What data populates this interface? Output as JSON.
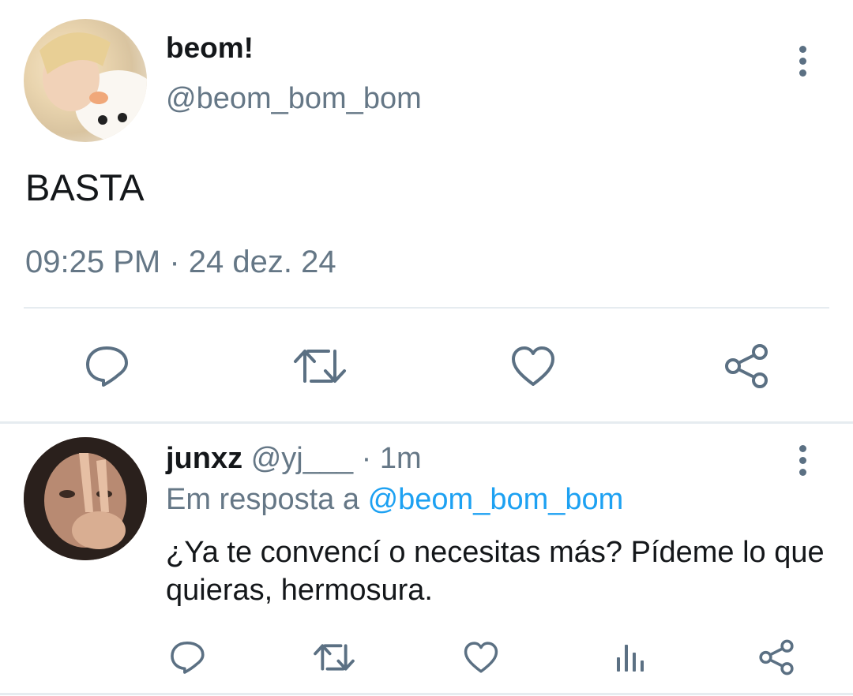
{
  "main_tweet": {
    "display_name": "beom!",
    "handle": "@beom_bom_bom",
    "text": "BASTA",
    "time": "09:25 PM",
    "separator": "·",
    "date": "24 dez. 24",
    "avatar": "user-photo"
  },
  "reply": {
    "display_name": "junxz",
    "handle": "@yj___",
    "separator": "·",
    "age": "1m",
    "reply_prefix": "Em resposta a",
    "reply_mention": "@beom_bom_bom",
    "text": "¿Ya te convencí o necesitas más? Pídeme lo que quieras, hermosura.",
    "avatar": "user-photo"
  },
  "icons": {
    "reply": "comment-bubble-icon",
    "retweet": "retweet-icon",
    "like": "heart-icon",
    "share": "share-icon",
    "analytics": "analytics-bars-icon",
    "more": "more-vertical-icon"
  },
  "colors": {
    "text": "#14171a",
    "secondary": "#657786",
    "icon": "#5b7083",
    "link": "#1da1f2",
    "divider": "#e6ecf0"
  }
}
